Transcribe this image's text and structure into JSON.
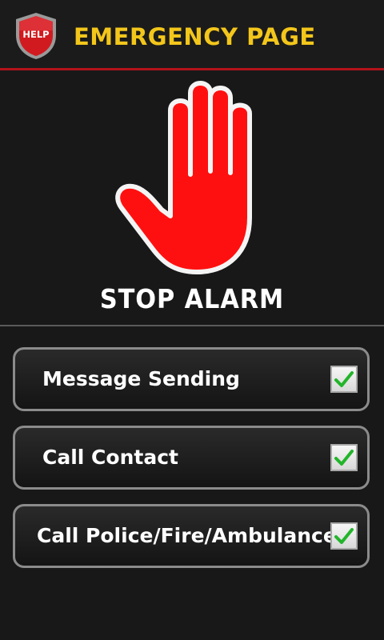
{
  "header": {
    "logo_text": "HELP",
    "title": "EMERGENCY PAGE"
  },
  "stop": {
    "label": "STOP ALARM",
    "icon": "stop-hand-icon"
  },
  "options": [
    {
      "label": "Message Sending",
      "checked": true
    },
    {
      "label": "Call Contact",
      "checked": true
    },
    {
      "label": "Call Police/Fire/Ambulance",
      "checked": true
    }
  ],
  "colors": {
    "background": "#181818",
    "title": "#f3c61b",
    "header_rule": "#b3121a",
    "hand": "#ff1010",
    "check": "#22b52a"
  }
}
